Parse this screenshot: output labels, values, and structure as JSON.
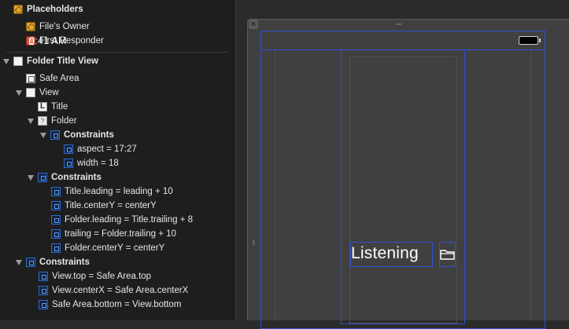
{
  "outline": {
    "placeholders": {
      "label": "Placeholders",
      "items": [
        {
          "label": "File's Owner",
          "icon": "cube-icon"
        },
        {
          "label": "First Responder",
          "icon": "first-responder-icon"
        }
      ]
    },
    "root": {
      "label": "Folder Title View",
      "safe_area": "Safe Area",
      "view": {
        "label": "View",
        "title": "Title",
        "folder": {
          "label": "Folder",
          "constraints_label": "Constraints",
          "constraints": [
            "aspect = 17:27",
            "width = 18"
          ]
        },
        "constraints_label": "Constraints",
        "constraints": [
          "Title.leading = leading + 10",
          "Title.centerY = centerY",
          "Folder.leading = Title.trailing + 8",
          "trailing = Folder.trailing + 10",
          "Folder.centerY = centerY"
        ]
      },
      "constraints_label": "Constraints",
      "constraints": [
        "View.top = Safe Area.top",
        "View.centerX = Safe Area.centerX",
        "Safe Area.bottom = View.bottom"
      ]
    }
  },
  "canvas": {
    "status_time": "9:41 AM",
    "title_label": "Listening",
    "close_glyph": "×",
    "colors": {
      "constraint_blue": "#3150d6",
      "canvas_bg": "#404040",
      "outline_bg": "#1e1e1e"
    }
  }
}
